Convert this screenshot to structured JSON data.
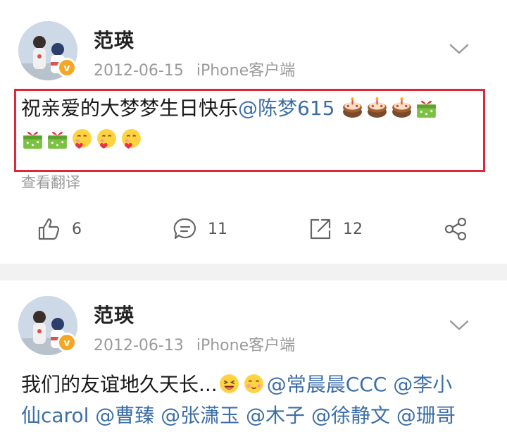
{
  "posts": [
    {
      "author": "范瑛",
      "date": "2012-06-15",
      "source": "iPhone客户端",
      "text_plain": "祝亲爱的大梦梦生日快乐",
      "mention": "@陈梦615",
      "translate_label": "查看翻译",
      "stats": {
        "likes": "6",
        "comments": "11",
        "reposts": "12"
      }
    },
    {
      "author": "范瑛",
      "date": "2012-06-13",
      "source": "iPhone客户端",
      "text_plain": "我们的友谊地久天长...",
      "mentions_line1": "@常晨晨CCC @李小",
      "mentions_line2": "仙carol @曹臻 @张潇玉 @木子 @徐静文 @珊哥"
    }
  ],
  "colors": {
    "highlight_border": "#e0263a",
    "mention": "#3c6ea8",
    "verified_badge": "#f5a623"
  }
}
